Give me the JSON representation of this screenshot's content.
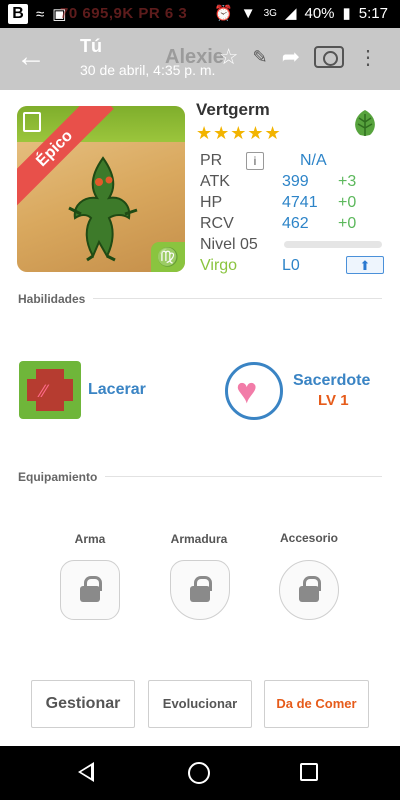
{
  "status_bar": {
    "app_letter": "B",
    "ghost_text": "70 695,9K PR 6 3",
    "network": "3G",
    "battery": "40%",
    "time": "5:17"
  },
  "action_bar": {
    "title": "Tú",
    "subtitle": "30 de abril, 4:35 p. m.",
    "behind_text": "Alexie"
  },
  "monster": {
    "name": "Vertgerm",
    "stars": "★★★★★",
    "rarity": "Épico",
    "element_icon": "leaf-icon",
    "zodiac_symbol": "♍",
    "stats": [
      {
        "key": "PR",
        "value": "N/A",
        "bonus": ""
      },
      {
        "key": "ATK",
        "value": "399",
        "bonus": "+3"
      },
      {
        "key": "HP",
        "value": "4741",
        "bonus": "+0"
      },
      {
        "key": "RCV",
        "value": "462",
        "bonus": "+0"
      }
    ],
    "level_label": "Nivel 05",
    "level_progress": 0,
    "zodiac_name": "Virgo",
    "limit": "L0"
  },
  "sections": {
    "skills": "Habilidades",
    "equipment": "Equipamiento"
  },
  "skills": [
    {
      "name": "Lacerar"
    },
    {
      "name": "Sacerdote",
      "level": "LV 1"
    }
  ],
  "equipment": [
    {
      "label": "Arma"
    },
    {
      "label": "Armadura"
    },
    {
      "label": "Accesorio"
    }
  ],
  "buttons": {
    "manage": "Gestionar",
    "evolve": "Evolucionar",
    "feed": "Da de Comer"
  },
  "colors": {
    "accent_blue": "#2d84c8",
    "bonus_green": "#5cb85c",
    "feed_orange": "#e65b1a",
    "rarity_red": "#e8504a",
    "star_gold": "#f2b400"
  }
}
